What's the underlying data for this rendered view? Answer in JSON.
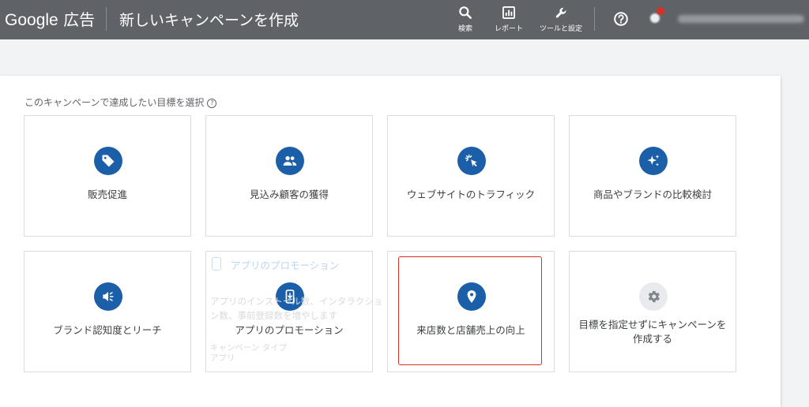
{
  "header": {
    "logo_brand": "Google",
    "logo_suffix": "広告",
    "title": "新しいキャンペーンを作成",
    "tools": [
      {
        "label": "検索",
        "icon": "search-icon"
      },
      {
        "label": "レポート",
        "icon": "report-icon"
      },
      {
        "label": "ツールと設定",
        "icon": "wrench-icon"
      }
    ],
    "help_icon": "help-icon",
    "notification_icon": "notification-icon"
  },
  "main": {
    "prompt": "このキャンペーンで達成したい目標を選択",
    "goals": [
      {
        "label": "販売促進",
        "icon": "tag-icon",
        "selected": false
      },
      {
        "label": "見込み顧客の獲得",
        "icon": "people-icon",
        "selected": false
      },
      {
        "label": "ウェブサイトのトラフィック",
        "icon": "cursor-click-icon",
        "selected": false
      },
      {
        "label": "商品やブランドの比較検討",
        "icon": "sparkle-icon",
        "selected": false
      },
      {
        "label": "ブランド認知度とリーチ",
        "icon": "megaphone-icon",
        "selected": false
      },
      {
        "label": "アプリのプロモーション",
        "icon": "phone-download-icon",
        "selected": false
      },
      {
        "label": "来店数と店舗売上の向上",
        "icon": "location-pin-icon",
        "selected": true
      },
      {
        "label": "目標を指定せずにキャンペーンを作成する",
        "icon": "gear-icon",
        "selected": false
      }
    ],
    "ghost_tooltip": {
      "title": "アプリのプロモーション",
      "description": "アプリのインストール数、インタラクション数、事前登録数を増やします",
      "type_label": "キャンペーン タイプ",
      "type_value": "アプリ"
    }
  },
  "colors": {
    "topbar": "#5f6368",
    "accent": "#1a5fa8",
    "selected_outline": "#d93025"
  }
}
